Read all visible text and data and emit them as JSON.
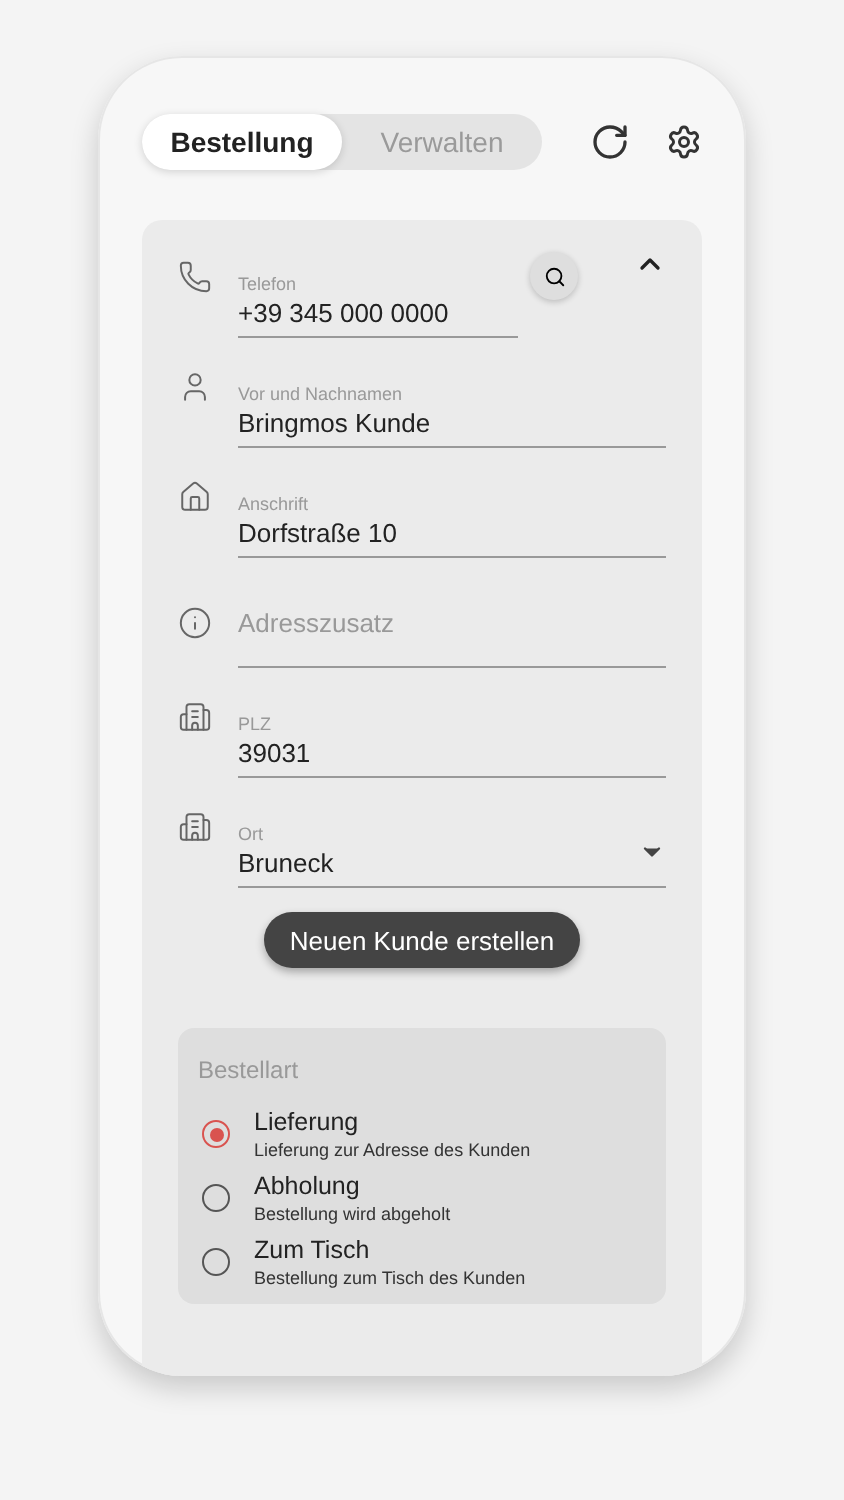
{
  "tabs": [
    {
      "label": "Bestellung",
      "selected": true
    },
    {
      "label": "Verwalten",
      "selected": false
    }
  ],
  "customer": {
    "expanded": true,
    "fields": [
      {
        "kind": "phone",
        "label": "Telefon",
        "value": "+39 345 000 0000",
        "search": true
      },
      {
        "kind": "person",
        "label": "Vor und Nachnamen",
        "value": "Bringmos Kunde"
      },
      {
        "kind": "home",
        "label": "Anschrift",
        "value": "Dorfstraße 10"
      },
      {
        "kind": "info",
        "placeholder": "Adresszusatz"
      },
      {
        "kind": "building",
        "label": "PLZ",
        "value": "39031"
      },
      {
        "kind": "building",
        "label": "Ort",
        "value": "Bruneck",
        "dropdown": true
      }
    ],
    "button": "Neuen Kunde erstellen"
  },
  "order_type": {
    "title": "Bestellart",
    "options": [
      {
        "label": "Lieferung",
        "description": "Lieferung zur Adresse des Kunden",
        "selected": true
      },
      {
        "label": "Abholung",
        "description": "Bestellung wird abgeholt",
        "selected": false
      },
      {
        "label": "Zum Tisch",
        "description": "Bestellung zum Tisch des Kunden",
        "selected": false
      }
    ]
  }
}
